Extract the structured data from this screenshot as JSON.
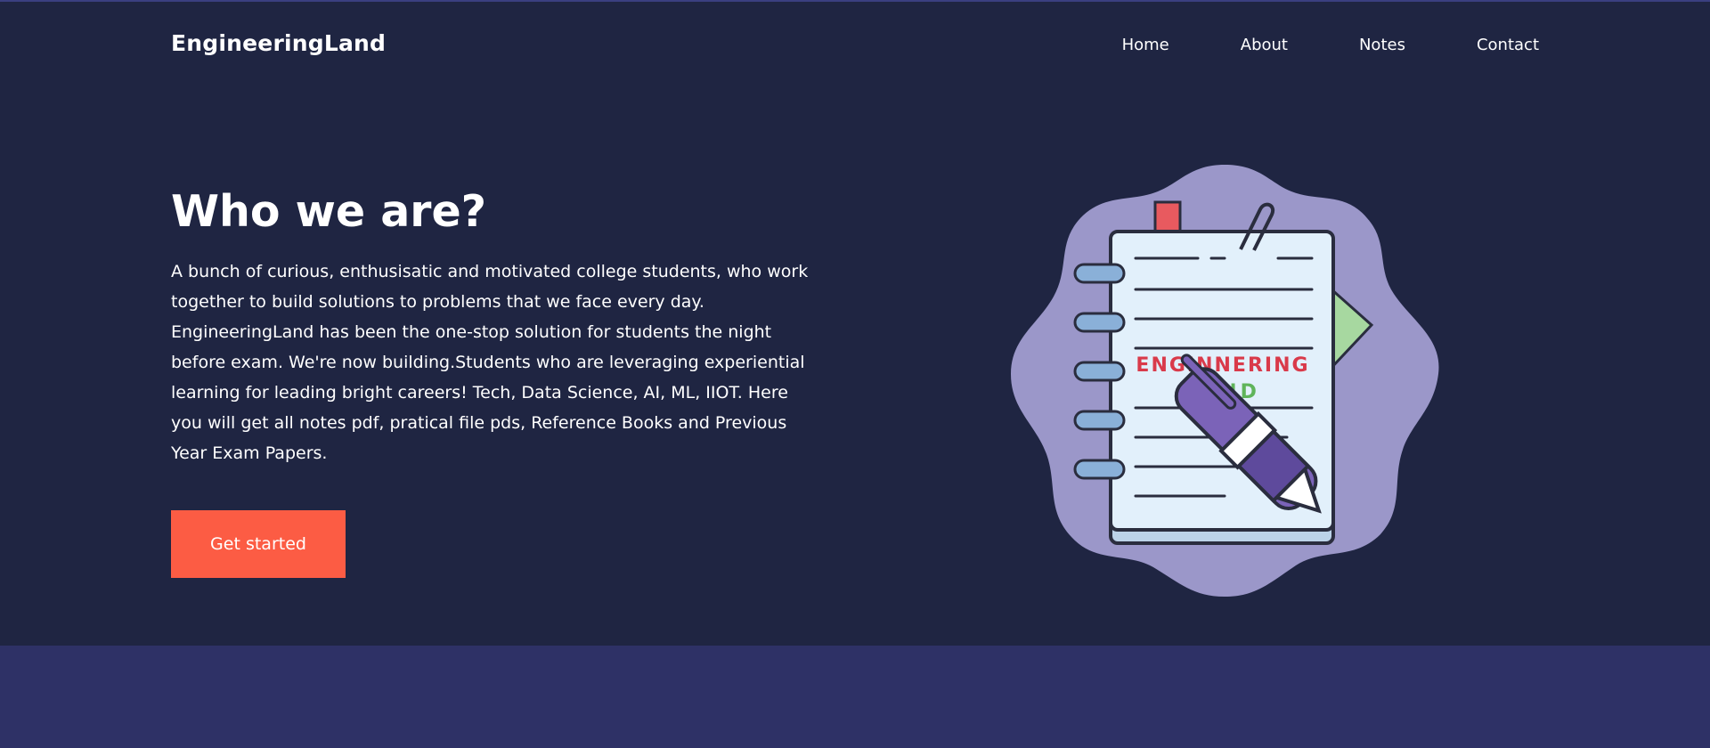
{
  "nav": {
    "brand": "EngineeringLand",
    "links": [
      "Home",
      "About",
      "Notes",
      "Contact"
    ]
  },
  "hero": {
    "title": "Who we are?",
    "description": "A bunch of curious, enthusisatic and motivated college students, who work together to build solutions to problems that we face every day. EngineeringLand has been the one-stop solution for students the night before exam. We're now building.Students who are leveraging experiential learning for leading bright careers! Tech, Data Science, AI, ML, IIOT. Here you will get all notes pdf, pratical file pds, Reference Books and Previous Year Exam Papers.",
    "cta": "Get started"
  },
  "illustration": {
    "line1": "ENGINNERING",
    "line2": "LAND"
  },
  "colors": {
    "background": "#1f2542",
    "accent": "#fc5c44",
    "band": "#2e3166",
    "blob": "#9b97c9"
  }
}
